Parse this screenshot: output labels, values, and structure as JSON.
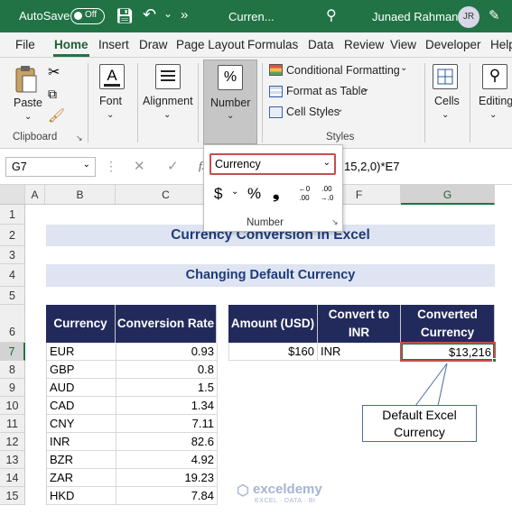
{
  "titlebar": {
    "autosave_label": "AutoSave",
    "autosave_state": "Off",
    "file_name": "Curren...",
    "more": "»",
    "user_name": "Junaed Rahman",
    "user_initials": "JR"
  },
  "tabs": [
    "File",
    "Home",
    "Insert",
    "Draw",
    "Page Layout",
    "Formulas",
    "Data",
    "Review",
    "View",
    "Developer",
    "Help"
  ],
  "ribbon": {
    "paste": "Paste",
    "clipboard": "Clipboard",
    "font": "Font",
    "alignment": "Alignment",
    "number": "Number",
    "number_icon": "%",
    "conditional": "Conditional Formatting",
    "format_table": "Format as Table",
    "cell_styles": "Cell Styles",
    "styles": "Styles",
    "cells": "Cells",
    "editing": "Editing"
  },
  "formula_bar": {
    "name_box": "G7",
    "fx": "fx",
    "formula_visible": "15,2,0)*E7"
  },
  "number_popup": {
    "format_value": "Currency",
    "dollar": "$",
    "percent": "%",
    "comma": "❟",
    "inc_decimal_top": "←0",
    "inc_decimal_bottom": ".00",
    "dec_decimal_top": ".00",
    "dec_decimal_bottom": "→.0",
    "group_label": "Number"
  },
  "columns": [
    "A",
    "B",
    "C",
    "D",
    "E",
    "F",
    "G"
  ],
  "rows": [
    "1",
    "2",
    "3",
    "4",
    "5",
    "6",
    "7",
    "8",
    "9",
    "10",
    "11",
    "12",
    "13",
    "14",
    "15"
  ],
  "sheet": {
    "title": "Currency Conversion in Excel",
    "subtitle": "Changing Default Currency",
    "table1_headers": [
      "Currency",
      "Conversion Rate"
    ],
    "table1_rows": [
      [
        "EUR",
        "0.93"
      ],
      [
        "GBP",
        "0.8"
      ],
      [
        "AUD",
        "1.5"
      ],
      [
        "CAD",
        "1.34"
      ],
      [
        "CNY",
        "7.11"
      ],
      [
        "INR",
        "82.6"
      ],
      [
        "BZR",
        "4.92"
      ],
      [
        "ZAR",
        "19.23"
      ],
      [
        "HKD",
        "7.84"
      ]
    ],
    "table2_headers": [
      "Amount (USD)",
      "Convert to INR",
      "Converted Currency"
    ],
    "table2_row": [
      "$160",
      "INR",
      "$13,216"
    ],
    "callout": "Default Excel Currency"
  },
  "watermark": {
    "name": "exceldemy",
    "tagline": "EXCEL · DATA · BI"
  }
}
